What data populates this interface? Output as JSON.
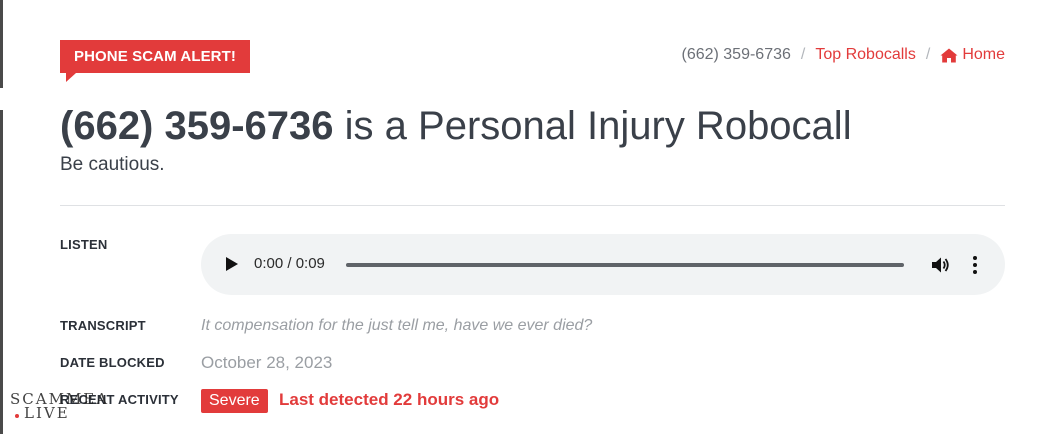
{
  "alert_badge": {
    "label": "PHONE SCAM ALERT!"
  },
  "breadcrumb": {
    "current": "(662) 359-6736",
    "separator": "/",
    "top_robocalls": "Top Robocalls",
    "home": "Home",
    "home_icon": "home-icon"
  },
  "headline": {
    "number": "(662) 359-6736",
    "rest": " is a Personal Injury Robocall",
    "subline": "Be cautious."
  },
  "rows": {
    "listen_label": "LISTEN",
    "transcript_label": "TRANSCRIPT",
    "transcript_value": "It compensation for the just tell me, have we ever died?",
    "date_label": "DATE BLOCKED",
    "date_value": "October 28, 2023",
    "activity_label": "RECENT ACTIVITY",
    "severity": "Severe",
    "last_detected": "Last detected 22 hours ago"
  },
  "audio_player": {
    "time_display": "0:00 / 0:09",
    "icons": [
      "play-icon",
      "volume-icon",
      "more-vert-icon"
    ]
  },
  "watermark": {
    "line1": "SCAMMEA",
    "line2": "LIVE"
  },
  "colors": {
    "accent": "#e23b3b",
    "text": "#3a4049",
    "muted": "#9a9ea3",
    "player_bg": "#f1f3f4"
  }
}
